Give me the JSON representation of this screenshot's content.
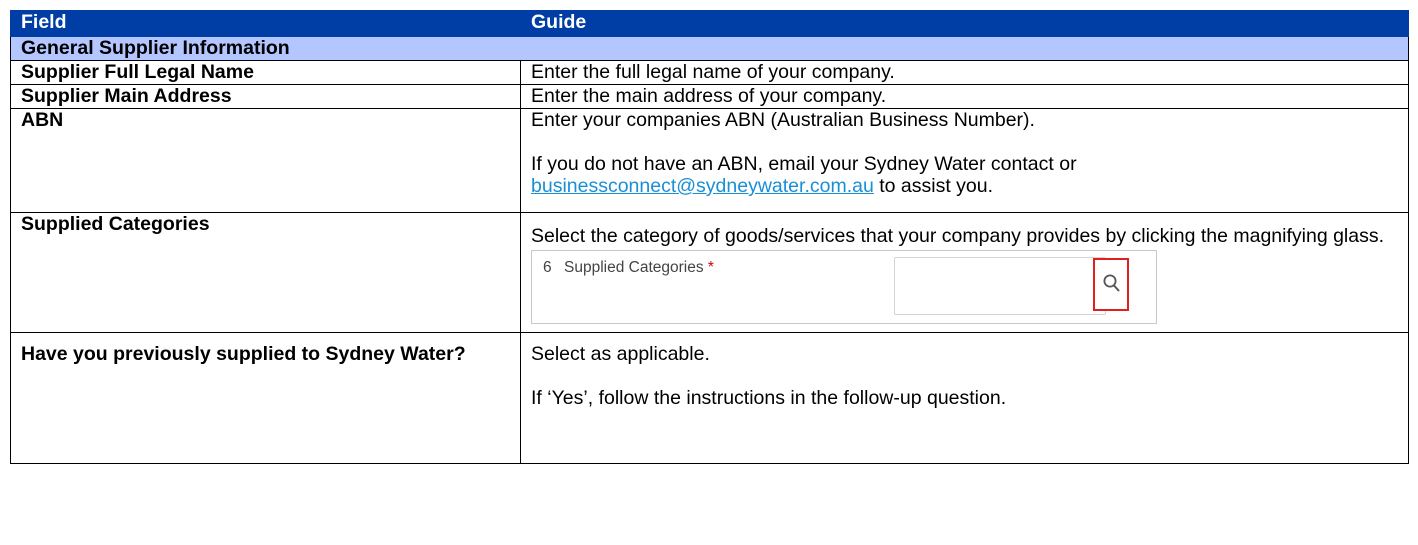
{
  "header": {
    "field": "Field",
    "guide": "Guide"
  },
  "section": {
    "title": "General Supplier Information"
  },
  "rows": {
    "legal_name": {
      "field": "Supplier Full Legal Name",
      "guide": "Enter the full legal name of your company."
    },
    "main_address": {
      "field": "Supplier Main Address",
      "guide": "Enter the main address of your company."
    },
    "abn": {
      "field": "ABN",
      "guide_line1": "Enter your companies ABN (Australian Business Number).",
      "guide_line2_part1": "If you do not have an ABN, email your Sydney Water contact or",
      "email": "businessconnect@sydneywater.com.au",
      "guide_line2_part2": " to assist you."
    },
    "categories": {
      "field": "Supplied Categories",
      "guide": "Select the category of goods/services that your company provides by clicking the magnifying glass.",
      "snippet": {
        "number": "6",
        "label": "Supplied Categories",
        "required_mark": "*",
        "icon": "search-icon"
      }
    },
    "previous": {
      "field": "Have you previously supplied to Sydney Water?",
      "guide_line1": "Select as applicable.",
      "guide_line2": "If ‘Yes’, follow the instructions in the follow-up question."
    }
  },
  "colors": {
    "header_bg": "#003da5",
    "section_bg": "#b4c6ff",
    "link": "#1a8fd6",
    "highlight": "#e02020"
  }
}
